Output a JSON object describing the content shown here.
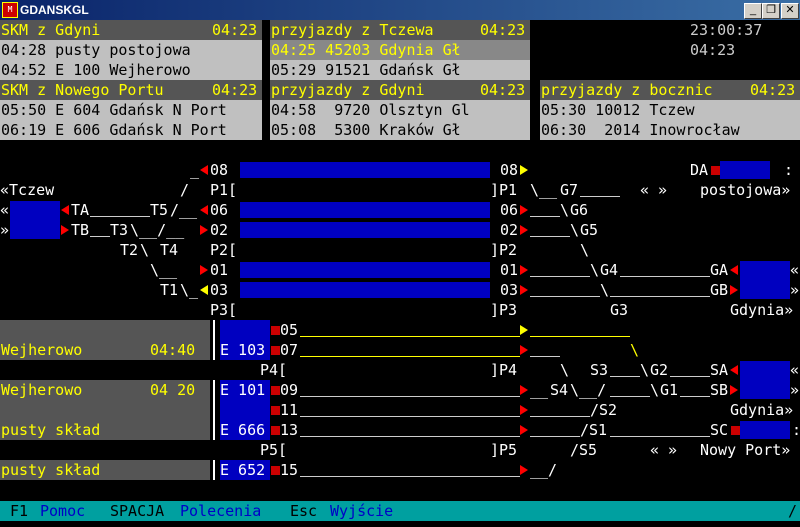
{
  "window": {
    "title": "GDANSKGL",
    "minimize": "_",
    "restore": "❐",
    "close": "✕",
    "app_icon": "M"
  },
  "clock": {
    "time": "23:00:37",
    "short": "04:23"
  },
  "panels": {
    "skm_gdyni": {
      "title": "SKM z Gdyni",
      "time": "04:23",
      "rows": [
        "04:28 pusty postojowa",
        "04:52 E 100 Wejherowo"
      ]
    },
    "przyj_tczewa": {
      "title": "przyjazdy z Tczewa",
      "time": "04:23",
      "rows": [
        "04:25 45203 Gdynia Gł",
        "05:29 91521 Gdańsk Gł"
      ]
    },
    "skm_nowego_portu": {
      "title": "SKM z Nowego Portu",
      "time": "04:23",
      "rows": [
        "05:50 E 604 Gdańsk N Port",
        "06:19 E 606 Gdańsk N Port"
      ]
    },
    "przyj_gdyni": {
      "title": "przyjazdy z Gdyni",
      "time": "04:23",
      "rows": [
        "04:58  9720 Olsztyn Gl",
        "05:08  5300 Kraków Gł"
      ]
    },
    "przyj_bocznic": {
      "title": "przyjazdy z bocznic",
      "time": "04:23",
      "rows": [
        "05:30 10012 Tczew",
        "06:30  2014 Inowrocław"
      ]
    }
  },
  "track_labels": {
    "t08": "08",
    "t06": "06",
    "t02": "02",
    "t01": "01",
    "t03": "03",
    "t05": "05",
    "t07": "07",
    "t09": "09",
    "t11": "11",
    "t13": "13",
    "t15": "15",
    "p1l": "P1[",
    "p1r": "]P1",
    "p2l": "P2[",
    "p2r": "]P2",
    "p3l": "P3[",
    "p3r": "]P3",
    "p4l": "P4[",
    "p4r": "]P4",
    "p5l": "P5[",
    "p5r": "]P5",
    "tczew_l": "«Tczew",
    "ta": "TA",
    "tb": "TB",
    "t3": "T3",
    "t5": "T5",
    "t2": "T2",
    "t4": "T4",
    "t1": "T1",
    "g7": "G7",
    "g6": "G6",
    "g5": "G5",
    "g4": "G4",
    "g3": "G3",
    "g2": "G2",
    "g1": "G1",
    "ga": "GA",
    "gb": "GB",
    "gdynia": "Gdynia»",
    "da": "DA",
    "postojowa": "postojowa»",
    "s3": "S3",
    "s4": "S4",
    "s2": "/S2",
    "s1": "/S1",
    "s5": "/S5",
    "sa": "SA",
    "sb": "SB",
    "sc": "SC",
    "nowy_port": "Nowy Port»",
    "gdynia2": "Gdynia»",
    "guillemets": "« »"
  },
  "left_trains": [
    {
      "dest": "Wejherowo",
      "time": "04:40",
      "unit": "E 103"
    },
    {
      "dest": "Wejherowo",
      "time": "04 20",
      "unit": "E 101"
    },
    {
      "dest": "pusty skład",
      "time": "",
      "unit": "E 666"
    },
    {
      "dest": "pusty skład",
      "time": "",
      "unit": "E 652"
    }
  ],
  "statusbar": {
    "f1_key": "F1",
    "f1_label": "Pomoc",
    "space_key": "SPACJA",
    "space_label": "Polecenia",
    "esc_key": "Esc",
    "esc_label": "Wyjście",
    "end": "/"
  },
  "colors": {
    "track_blue": "#0000c0",
    "signal_red": "#ff0000",
    "signal_yellow": "#ffff00",
    "status_bg": "#00a0a0"
  }
}
